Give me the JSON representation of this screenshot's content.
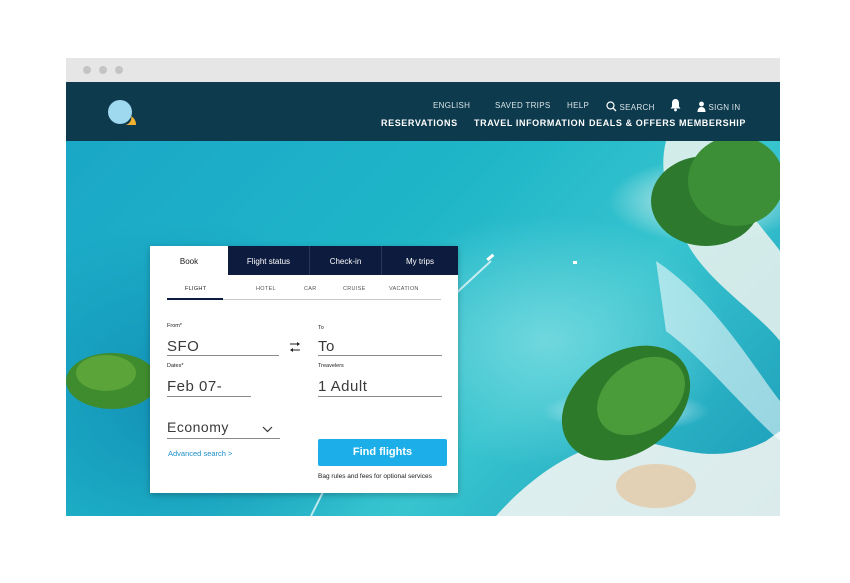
{
  "header": {
    "top_links": {
      "english": "ENGLISH",
      "saved_trips": "SAVED TRIPS",
      "help": "HELP",
      "search": "SEARCH",
      "sign_in": "SIGN IN"
    },
    "main_nav": [
      "RESERVATIONS",
      "TRAVEL INFORMATION",
      "DEALS & OFFERS",
      "MEMBERSHIP"
    ]
  },
  "booking": {
    "tabs": [
      "Book",
      "Flight status",
      "Check-in",
      "My trips"
    ],
    "subtabs": [
      "FLIGHT",
      "HOTEL",
      "CAR",
      "CRUISE",
      "VACATION"
    ],
    "from": {
      "label": "From*",
      "value": "SFO"
    },
    "to": {
      "label": "To",
      "value": "To"
    },
    "dates": {
      "label": "Dates*",
      "value": "Feb 07-"
    },
    "travelers": {
      "label": "Treavelers",
      "value": "1 Adult"
    },
    "cabin": {
      "value": "Economy"
    },
    "advanced_search": "Advanced search >",
    "find_button": "Find flights",
    "bag_note": "Bag rules and fees for optional services"
  },
  "icons": [
    "logo-icon",
    "search-icon",
    "bell-icon",
    "user-icon",
    "swap-arrows-icon",
    "chevron-down-icon"
  ],
  "colors": {
    "header_bg": "#0d3a4c",
    "tabs_bg": "#0d1b3e",
    "button": "#1baee8",
    "logo_circle": "#9fd9f0",
    "logo_accent": "#f2b230"
  }
}
